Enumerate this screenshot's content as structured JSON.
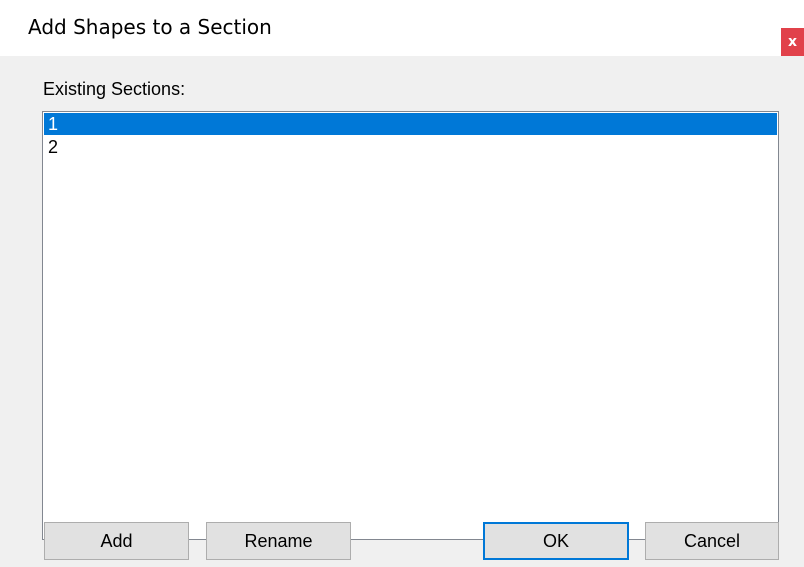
{
  "window": {
    "title": "Add Shapes to a Section",
    "close_glyph": "x",
    "close_color": "#e1414a"
  },
  "sections": {
    "label": "Existing Sections:",
    "items": [
      "1",
      "2"
    ],
    "selected_index": 0,
    "selection_color": "#0078d7"
  },
  "buttons": {
    "add_label": "Add",
    "rename_label": "Rename",
    "ok_label": "OK",
    "cancel_label": "Cancel"
  }
}
